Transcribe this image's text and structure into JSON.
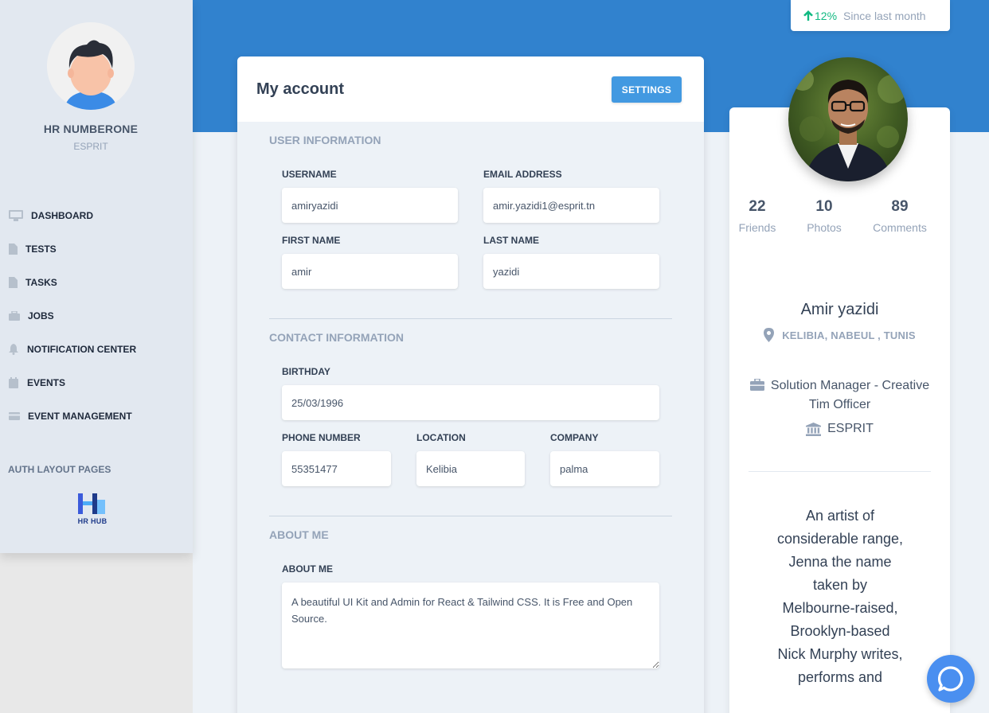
{
  "sidebar": {
    "user_name": "HR NUMBERONE",
    "user_org": "ESPRIT",
    "items": [
      {
        "label": "DASHBOARD",
        "icon": "monitor-icon"
      },
      {
        "label": "TESTS",
        "icon": "file-icon"
      },
      {
        "label": "TASKS",
        "icon": "file-icon"
      },
      {
        "label": "JOBS",
        "icon": "briefcase-icon"
      },
      {
        "label": "NOTIFICATION CENTER",
        "icon": "bell-icon"
      },
      {
        "label": "EVENTS",
        "icon": "calendar-icon"
      },
      {
        "label": "EVENT MANAGEMENT",
        "icon": "card-icon"
      }
    ],
    "section_label": "AUTH LAYOUT PAGES",
    "brand_text": "HR HUB"
  },
  "stat": {
    "percent": "12%",
    "since": "Since last month"
  },
  "account": {
    "title": "My account",
    "settings_label": "SETTINGS",
    "user_info_title": "USER INFORMATION",
    "username_label": "USERNAME",
    "username_value": "amiryazidi",
    "email_label": "EMAIL ADDRESS",
    "email_value": "amir.yazidi1@esprit.tn",
    "first_name_label": "FIRST NAME",
    "first_name_value": "amir",
    "last_name_label": "LAST NAME",
    "last_name_value": "yazidi",
    "contact_title": "CONTACT INFORMATION",
    "birthday_label": "BIRTHDAY",
    "birthday_value": "25/03/1996",
    "phone_label": "PHONE NUMBER",
    "phone_value": "55351477",
    "location_label": "LOCATION",
    "location_value": "Kelibia",
    "company_label": "COMPANY",
    "company_value": "palma",
    "about_title": "ABOUT ME",
    "about_label": "ABOUT ME",
    "about_value": "A beautiful UI Kit and Admin for React & Tailwind CSS. It is Free and Open Source."
  },
  "profile": {
    "friends_count": "22",
    "friends_label": "Friends",
    "photos_count": "10",
    "photos_label": "Photos",
    "comments_count": "89",
    "comments_label": "Comments",
    "name": "Amir yazidi",
    "location": "KELIBIA, NABEUL , TUNIS",
    "job": "Solution Manager - Creative Tim Officer",
    "org": "ESPRIT",
    "bio": "An artist of considerable range, Jenna the name taken by Melbourne-raised, Brooklyn-based Nick Murphy writes, performs and"
  },
  "colors": {
    "header": "#3182ce",
    "button": "#4299e1",
    "positive": "#10b981"
  }
}
